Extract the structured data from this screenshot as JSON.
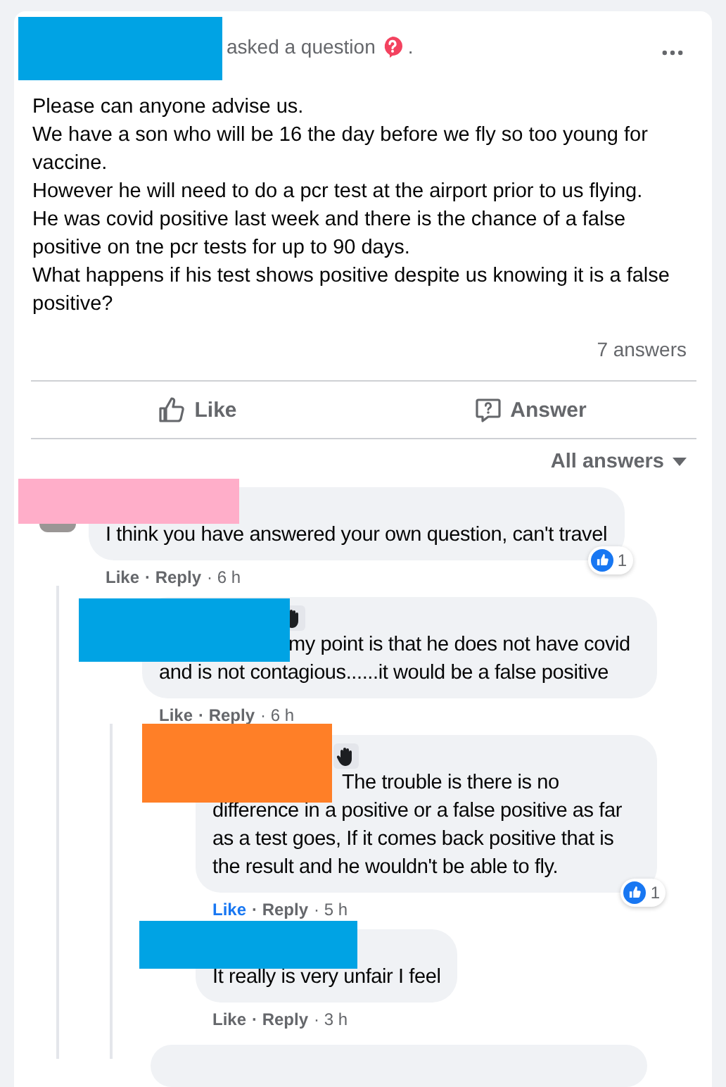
{
  "post": {
    "redaction": {
      "color": "#00a3e4"
    },
    "action": "asked a question",
    "trailing": ".",
    "body": [
      "Please can anyone advise us.",
      "We have a son who will be 16 the day before we fly so too young for vaccine.",
      "However he will need to do a pcr test at the airport prior to us flying.",
      "He was covid positive last week and there is the chance of a false positive on tne pcr tests for up to 90 days.",
      "What happens if his test shows positive despite us knowing it is a false positive?"
    ],
    "answers_count": "7 answers"
  },
  "actions": [
    {
      "kind": "like",
      "label": "Like"
    },
    {
      "kind": "answer",
      "label": "Answer"
    }
  ],
  "sort": {
    "label": "All answers"
  },
  "comments": [
    {
      "redaction": {
        "color": "#ffaec9"
      },
      "hand_badge": false,
      "mention": false,
      "text": "I think you have answered your own question, can't travel",
      "liked": false,
      "like": "Like",
      "reply": "· Reply",
      "time": "· 6 h",
      "reactions": "1",
      "children": [
        {
          "redaction": {
            "color": "#00a3e4"
          },
          "hand_badge": true,
          "mention": true,
          "text": "my point is that he does not have covid and is not contagious......it would be a false positive",
          "liked": false,
          "like": "Like",
          "reply": "· Reply",
          "time": "· 6 h",
          "children": [
            {
              "redaction": {
                "color": "#ff7f27"
              },
              "hand_badge": true,
              "mention": true,
              "text": "The trouble is there is no difference in a positive or a false positive as far as a test goes, If it comes back positive that is the result and he wouldn't be able to fly.",
              "liked": true,
              "like": "Like",
              "reply": "· Reply",
              "time": "· 5 h",
              "reactions": "1"
            },
            {
              "redaction": {
                "color": "#00a3e4"
              },
              "hand_badge": false,
              "mention": false,
              "text": "It really is very unfair I feel",
              "liked": false,
              "like": "Like",
              "reply": "· Reply",
              "time": "· 3 h"
            }
          ]
        }
      ]
    }
  ]
}
